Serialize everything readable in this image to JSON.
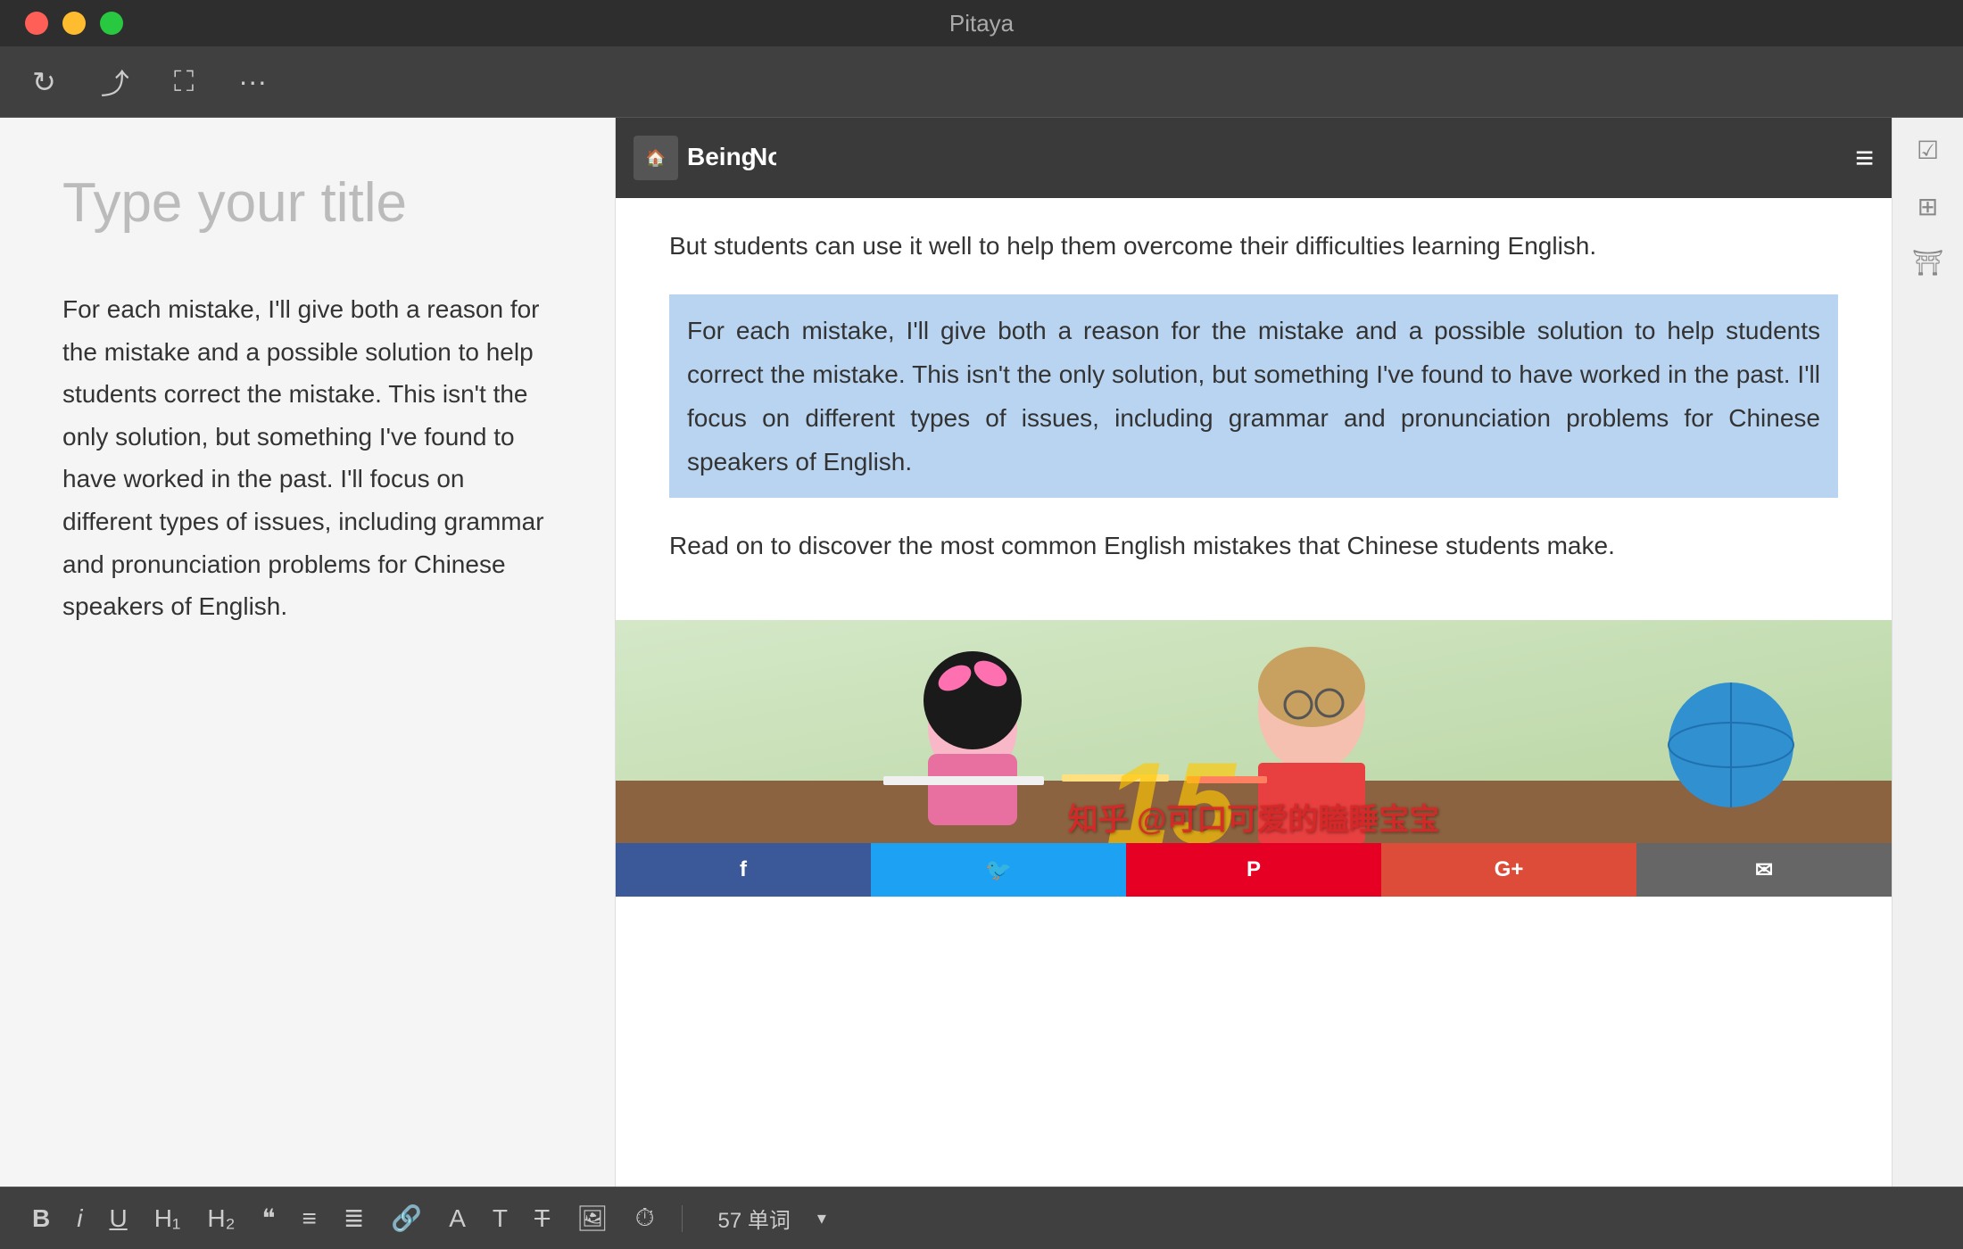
{
  "titlebar": {
    "title": "Pitaya"
  },
  "toolbar": {
    "icons": [
      "refresh",
      "share",
      "fullscreen",
      "more"
    ]
  },
  "editor": {
    "title_placeholder": "Type your title",
    "body_text": "For each mistake, I'll give both a reason for the mistake and a possible solution to help students correct the mistake. This isn't the only solution, but something I've found to have worked in the past. I'll focus on different types of issues, including grammar and pronunciation problems for Chinese speakers of English."
  },
  "web": {
    "logo_text": "Being Nomad",
    "header_intro": "But students can use it well to help them overcome their difficulties learning English.",
    "highlighted_paragraph": "For each mistake, I'll give both a reason for the mistake and a possible solution to help students correct the mistake. This isn't the only solution, but something I've found to have worked in the past. I'll focus on different types of issues, including grammar and pronunciation problems for Chinese speakers of English.",
    "read_on_text": "Read on to discover the most common English mistakes that Chinese students make.",
    "social_buttons": {
      "facebook": "f",
      "twitter": "t",
      "pinterest": "p",
      "google_plus": "G+",
      "email": "✉"
    }
  },
  "bottom_toolbar": {
    "word_count_label": "57 单词",
    "icons": [
      "bold",
      "italic",
      "underline",
      "h1",
      "h2",
      "quote",
      "list_ol",
      "list_ul",
      "link",
      "text_color",
      "font",
      "strikethrough",
      "image",
      "clock"
    ]
  },
  "watermark": {
    "text": "知乎 @可口可爱的瞌睡宝宝"
  }
}
